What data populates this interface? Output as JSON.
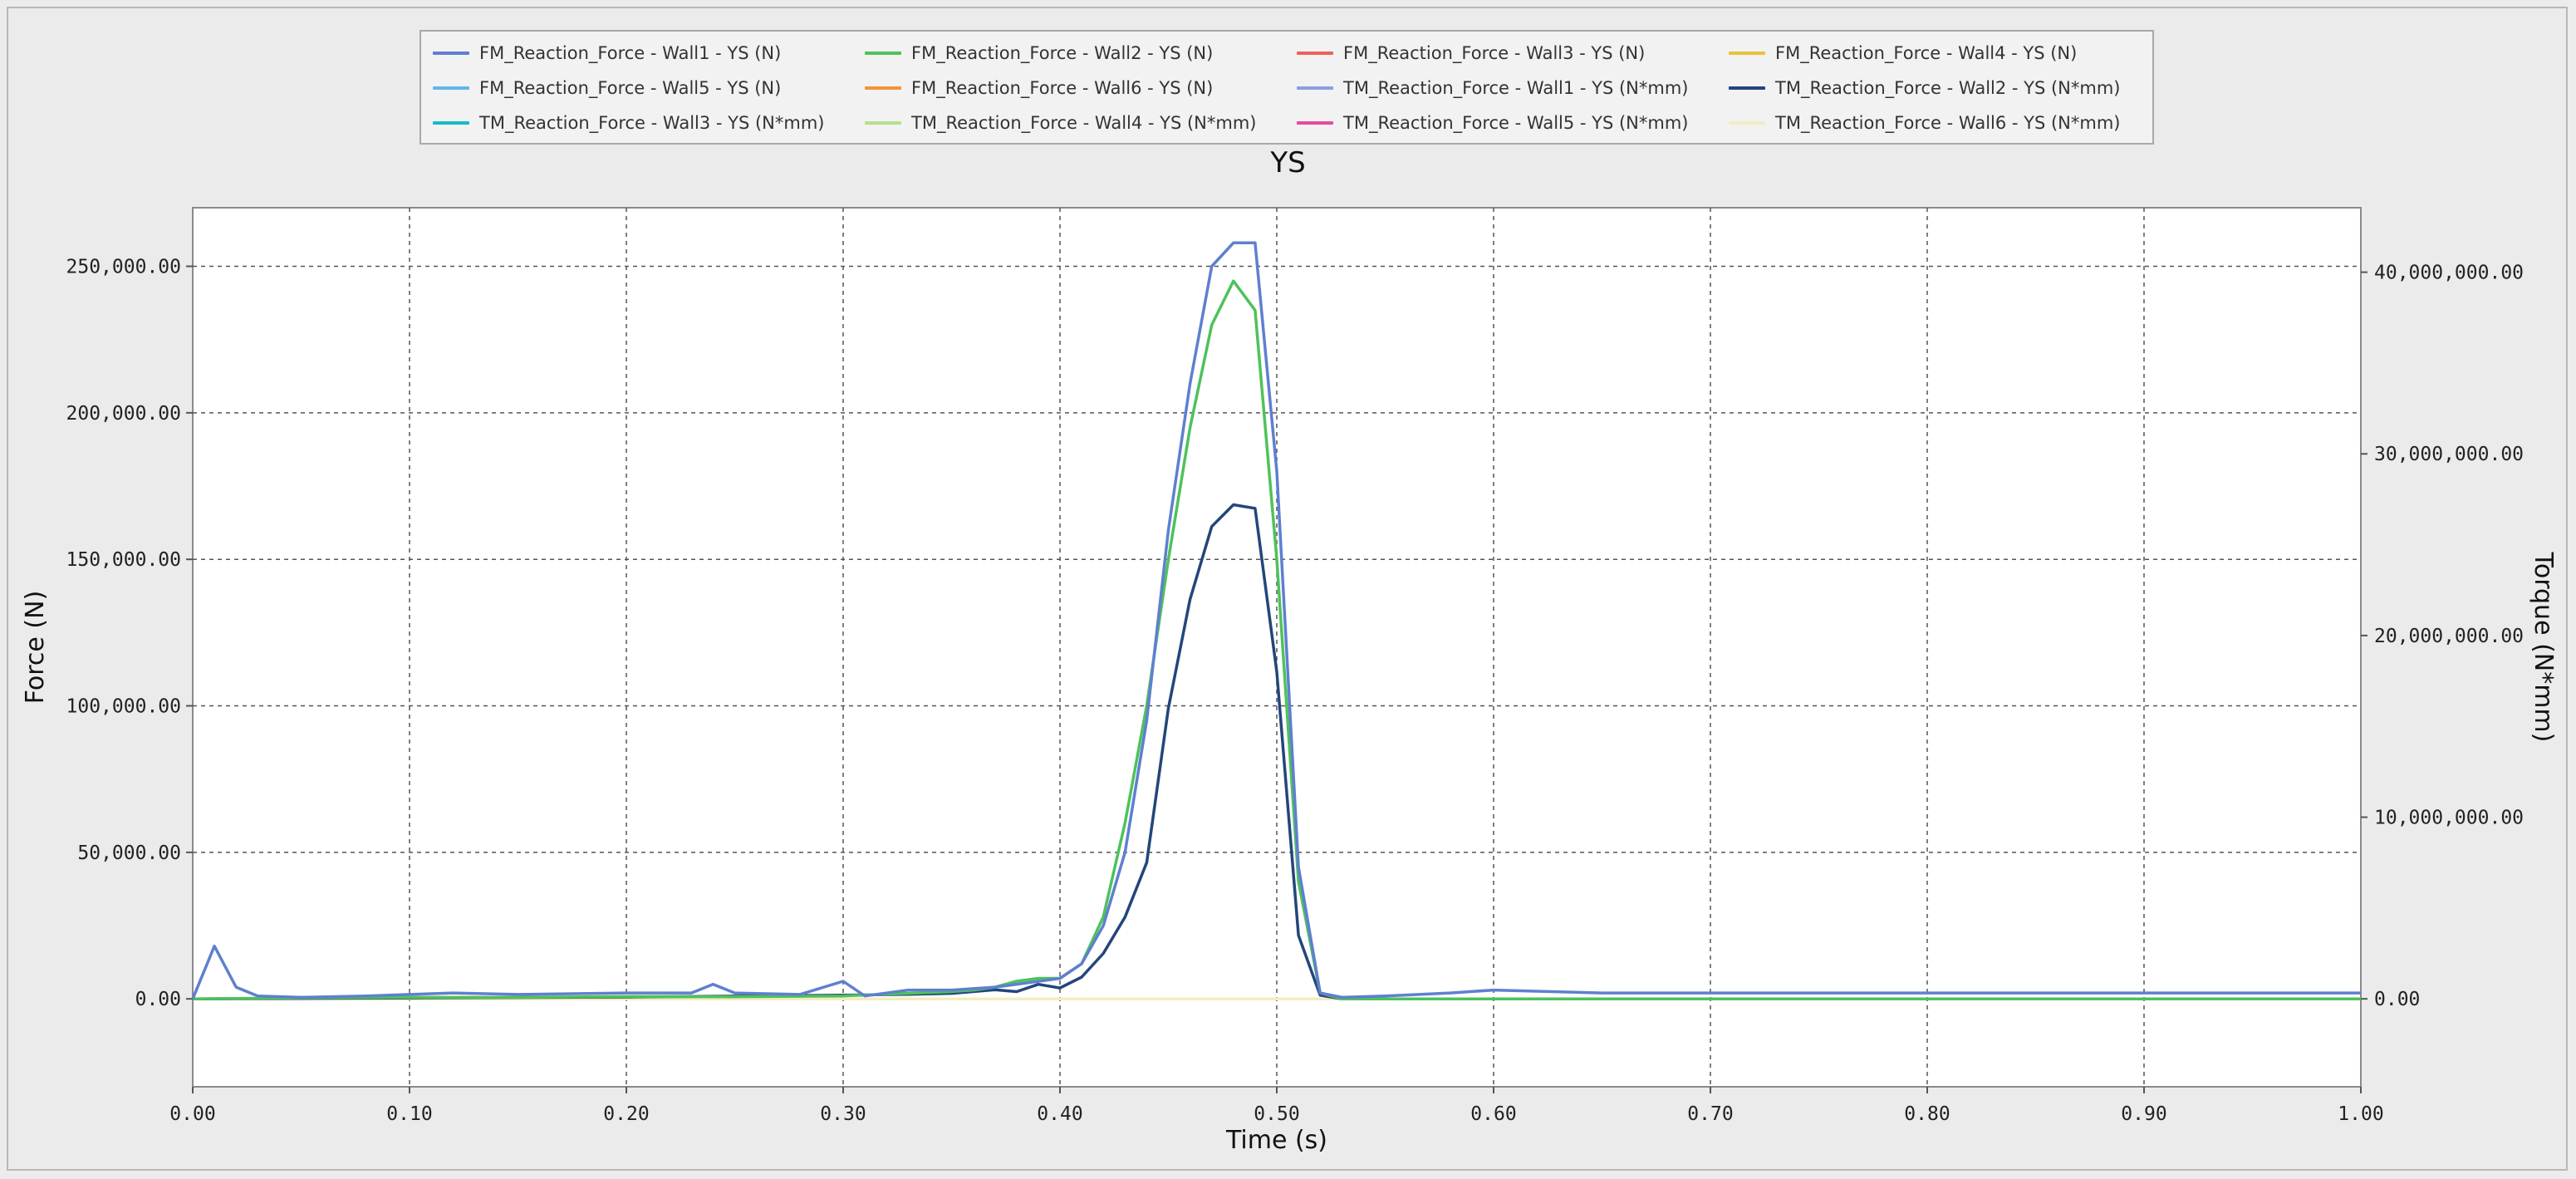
{
  "chart_data": {
    "type": "line",
    "title": "YS",
    "xlabel": "Time (s)",
    "ylabel": "Force (N)",
    "y2label": "Torque (N*mm)",
    "xlim": [
      0,
      1
    ],
    "ylim": [
      -30000,
      270000
    ],
    "y2lim": [
      -4838710,
      43548387
    ],
    "x_ticks": [
      0,
      0.1,
      0.2,
      0.3,
      0.4,
      0.5,
      0.6,
      0.7,
      0.8,
      0.9,
      1.0
    ],
    "x_tick_labels": [
      "0.00",
      "0.10",
      "0.20",
      "0.30",
      "0.40",
      "0.50",
      "0.60",
      "0.70",
      "0.80",
      "0.90",
      "1.00"
    ],
    "y_ticks": [
      0,
      50000,
      100000,
      150000,
      200000,
      250000
    ],
    "y_tick_labels": [
      "0.00",
      "50,000.00",
      "100,000.00",
      "150,000.00",
      "200,000.00",
      "250,000.00"
    ],
    "y2_ticks": [
      0,
      10000000,
      20000000,
      30000000,
      40000000
    ],
    "y2_tick_labels": [
      "0.00",
      "10,000,000.00",
      "20,000,000.00",
      "30,000,000.00",
      "40,000,000.00"
    ],
    "grid": true,
    "legend_position": "top",
    "series": [
      {
        "name": "FM_Reaction_Force - Wall1 - YS (N)",
        "color": "#5f7fd0",
        "axis": "left",
        "x": [
          0,
          0.01,
          0.02,
          0.03,
          0.05,
          0.08,
          0.1,
          0.12,
          0.15,
          0.2,
          0.23,
          0.24,
          0.25,
          0.28,
          0.3,
          0.31,
          0.33,
          0.35,
          0.37,
          0.38,
          0.4,
          0.41,
          0.42,
          0.43,
          0.44,
          0.45,
          0.46,
          0.47,
          0.48,
          0.49,
          0.5,
          0.51,
          0.52,
          0.53,
          0.55,
          0.58,
          0.6,
          0.65,
          0.7,
          0.8,
          0.9,
          1.0
        ],
        "y": [
          0,
          18000,
          4000,
          1000,
          500,
          1000,
          1500,
          2000,
          1500,
          2000,
          2000,
          5000,
          2000,
          1500,
          6000,
          1000,
          3000,
          3000,
          4000,
          5000,
          7000,
          12000,
          25000,
          50000,
          95000,
          160000,
          210000,
          250000,
          258000,
          258000,
          180000,
          45000,
          2000,
          500,
          1000,
          2000,
          3000,
          2000,
          2000,
          2000,
          2000,
          2000
        ]
      },
      {
        "name": "FM_Reaction_Force - Wall2 - YS (N)",
        "color": "#4ec25a",
        "axis": "left",
        "x": [
          0,
          0.05,
          0.1,
          0.15,
          0.2,
          0.25,
          0.3,
          0.35,
          0.36,
          0.37,
          0.38,
          0.39,
          0.4,
          0.41,
          0.42,
          0.43,
          0.44,
          0.45,
          0.46,
          0.47,
          0.48,
          0.49,
          0.5,
          0.51,
          0.52,
          0.53,
          0.6,
          0.7,
          0.8,
          0.9,
          1.0
        ],
        "y": [
          0,
          300,
          500,
          500,
          800,
          700,
          1000,
          2500,
          3000,
          4000,
          6000,
          7000,
          7000,
          12000,
          28000,
          60000,
          100000,
          150000,
          195000,
          230000,
          245000,
          235000,
          150000,
          40000,
          2000,
          0,
          0,
          0,
          0,
          0,
          0
        ]
      },
      {
        "name": "FM_Reaction_Force - Wall3 - YS (N)",
        "color": "#ee5f5f",
        "axis": "left",
        "x": [
          0,
          1
        ],
        "y": [
          0,
          0
        ]
      },
      {
        "name": "FM_Reaction_Force - Wall4 - YS (N)",
        "color": "#e8c23c",
        "axis": "left",
        "x": [
          0,
          1
        ],
        "y": [
          0,
          0
        ]
      },
      {
        "name": "FM_Reaction_Force - Wall5 - YS (N)",
        "color": "#62b6e6",
        "axis": "left",
        "x": [
          0,
          1
        ],
        "y": [
          0,
          0
        ]
      },
      {
        "name": "FM_Reaction_Force - Wall6 - YS (N)",
        "color": "#f29538",
        "axis": "left",
        "x": [
          0,
          1
        ],
        "y": [
          0,
          0
        ]
      },
      {
        "name": "TM_Reaction_Force - Wall1 - YS (N*mm)",
        "color": "#8a9ee0",
        "axis": "right",
        "x": [
          0,
          1
        ],
        "y": [
          0,
          0
        ]
      },
      {
        "name": "TM_Reaction_Force - Wall2 - YS (N*mm)",
        "color": "#23467a",
        "axis": "right",
        "x": [
          0,
          0.1,
          0.2,
          0.3,
          0.33,
          0.35,
          0.37,
          0.38,
          0.39,
          0.4,
          0.41,
          0.42,
          0.43,
          0.44,
          0.45,
          0.46,
          0.47,
          0.48,
          0.49,
          0.5,
          0.51,
          0.52,
          0.53,
          0.6,
          0.7,
          0.8,
          0.9,
          1.0
        ],
        "y": [
          0,
          50000,
          100000,
          200000,
          250000,
          300000,
          500000,
          400000,
          800000,
          600000,
          1200000,
          2500000,
          4500000,
          7500000,
          16000000,
          22000000,
          26000000,
          27200000,
          27000000,
          18000000,
          3500000,
          200000,
          0,
          0,
          0,
          0,
          0,
          0
        ]
      },
      {
        "name": "TM_Reaction_Force - Wall3 - YS (N*mm)",
        "color": "#12bdc6",
        "axis": "right",
        "x": [
          0,
          1
        ],
        "y": [
          0,
          0
        ]
      },
      {
        "name": "TM_Reaction_Force - Wall4 - YS (N*mm)",
        "color": "#b6e08a",
        "axis": "right",
        "x": [
          0,
          1
        ],
        "y": [
          0,
          0
        ]
      },
      {
        "name": "TM_Reaction_Force - Wall5 - YS (N*mm)",
        "color": "#e64c9c",
        "axis": "right",
        "x": [
          0,
          1
        ],
        "y": [
          0,
          0
        ]
      },
      {
        "name": "TM_Reaction_Force - Wall6 - YS (N*mm)",
        "color": "#f3ecc0",
        "axis": "right",
        "x": [
          0,
          1
        ],
        "y": [
          0,
          0
        ]
      }
    ]
  }
}
